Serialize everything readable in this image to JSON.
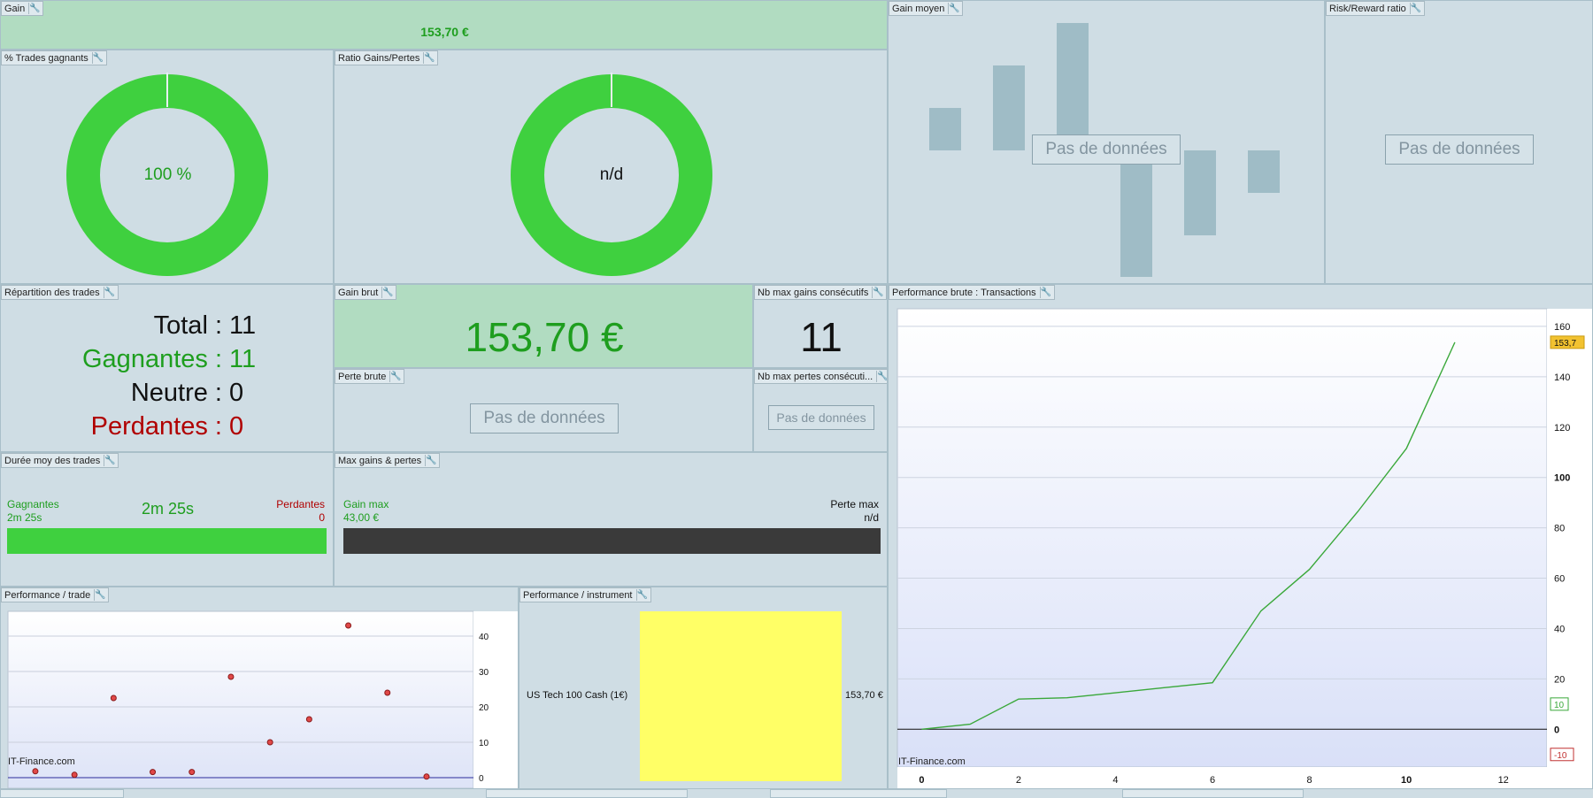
{
  "panels": {
    "gain": {
      "title": "Gain",
      "value": "153,70 €"
    },
    "pct_trades": {
      "title": "% Trades gagnants",
      "center": "100 %",
      "percent": 100
    },
    "ratio": {
      "title": "Ratio Gains/Pertes",
      "center": "n/d"
    },
    "gain_moyen": {
      "title": "Gain moyen",
      "nodata": "Pas de données"
    },
    "risk_reward": {
      "title": "Risk/Reward ratio",
      "nodata": "Pas de données"
    },
    "repartition": {
      "title": "Répartition des trades",
      "total_label": "Total :",
      "total_value": "11",
      "gagnantes_label": "Gagnantes :",
      "gagnantes_value": "11",
      "neutre_label": "Neutre :",
      "neutre_value": "0",
      "perdantes_label": "Perdantes :",
      "perdantes_value": "0"
    },
    "gain_brut": {
      "title": "Gain brut",
      "value": "153,70 €"
    },
    "nb_max_gains": {
      "title": "Nb max gains consécutifs",
      "value": "11"
    },
    "perte_brute": {
      "title": "Perte brute",
      "nodata": "Pas de données"
    },
    "nb_max_pertes": {
      "title": "Nb max pertes consécuti...",
      "nodata": "Pas de données"
    },
    "duree": {
      "title": "Durée moy des trades",
      "left_label": "Gagnantes",
      "left_value": "2m 25s",
      "center": "2m 25s",
      "right_label": "Perdantes",
      "right_value": "0"
    },
    "max_gains": {
      "title": "Max gains & pertes",
      "left_label": "Gain max",
      "left_value": "43,00 €",
      "right_label": "Perte max",
      "right_value": "n/d"
    },
    "perf_trade": {
      "title": "Performance / trade",
      "watermark": "IT-Finance.com"
    },
    "perf_instrument": {
      "title": "Performance / instrument",
      "instrument": "US Tech 100 Cash (1€)",
      "value": "153,70 €"
    },
    "perf_brute": {
      "title": "Performance brute : Transactions",
      "watermark": "IT-Finance.com",
      "last_value_badge": "153,7",
      "badge_10": "10",
      "badge_neg10": "-10"
    }
  },
  "colors": {
    "green": "#3fd03f",
    "dark_green": "#1e9e1e",
    "red": "#b00000",
    "yellow": "#ffff66",
    "panel_bg": "#cfdde4",
    "header_green": "#b1dcc1"
  },
  "chart_data": [
    {
      "type": "scatter",
      "name": "Performance / trade",
      "x": [
        1,
        2,
        3,
        4,
        5,
        6,
        7,
        8,
        9,
        10,
        11
      ],
      "y": [
        1.8,
        0.8,
        22.5,
        1.6,
        1.6,
        28.5,
        10,
        16.5,
        43,
        24,
        0.3
      ],
      "ylim": [
        -3,
        47
      ],
      "yticks": [
        "0",
        "10",
        "20",
        "30",
        "40"
      ]
    },
    {
      "type": "line",
      "name": "Performance brute : Transactions",
      "x": [
        0,
        1,
        2,
        3,
        4,
        5,
        6,
        7,
        8,
        9,
        10,
        11
      ],
      "y": [
        0,
        2,
        12,
        12.5,
        14.5,
        16.5,
        18.5,
        47,
        63.5,
        86.5,
        111.5,
        153.7
      ],
      "xlim": [
        -0.5,
        12.9
      ],
      "ylim": [
        -15,
        167
      ],
      "xticks": [
        "0",
        "2",
        "4",
        "6",
        "8",
        "10",
        "12"
      ],
      "yticks": [
        "0",
        "20",
        "40",
        "60",
        "80",
        "100",
        "120",
        "140",
        "160"
      ]
    }
  ]
}
